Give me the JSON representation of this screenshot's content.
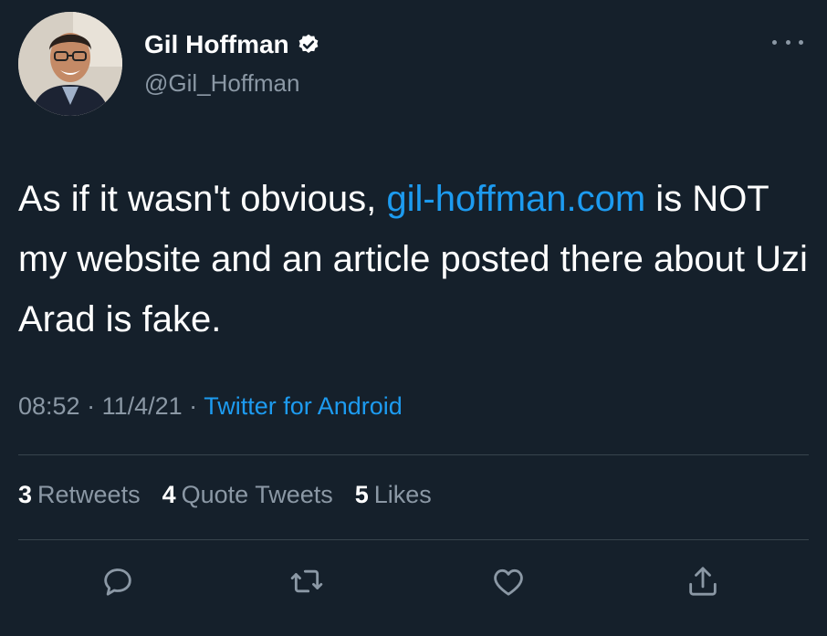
{
  "user": {
    "display_name": "Gil Hoffman",
    "handle": "@Gil_Hoffman",
    "verified_icon": "verified-badge-icon",
    "avatar": "profile photo"
  },
  "tweet": {
    "text_before_link": "As if it wasn't obvious, ",
    "link_text": "gil-hoffman.com",
    "text_after_link": " is NOT my website and an article posted there about Uzi Arad is fake."
  },
  "meta": {
    "time": "08:52",
    "separator": " · ",
    "date": "11/4/21",
    "source": "Twitter for Android"
  },
  "stats": {
    "retweets_count": "3",
    "retweets_label": "Retweets",
    "quote_count": "4",
    "quote_label": "Quote Tweets",
    "likes_count": "5",
    "likes_label": "Likes"
  },
  "colors": {
    "background": "#15202b",
    "link": "#1d9bf0",
    "secondary_text": "#8b98a5",
    "divider": "#38444d"
  },
  "icons": [
    "more-icon",
    "reply-icon",
    "retweet-icon",
    "like-icon",
    "share-icon"
  ]
}
